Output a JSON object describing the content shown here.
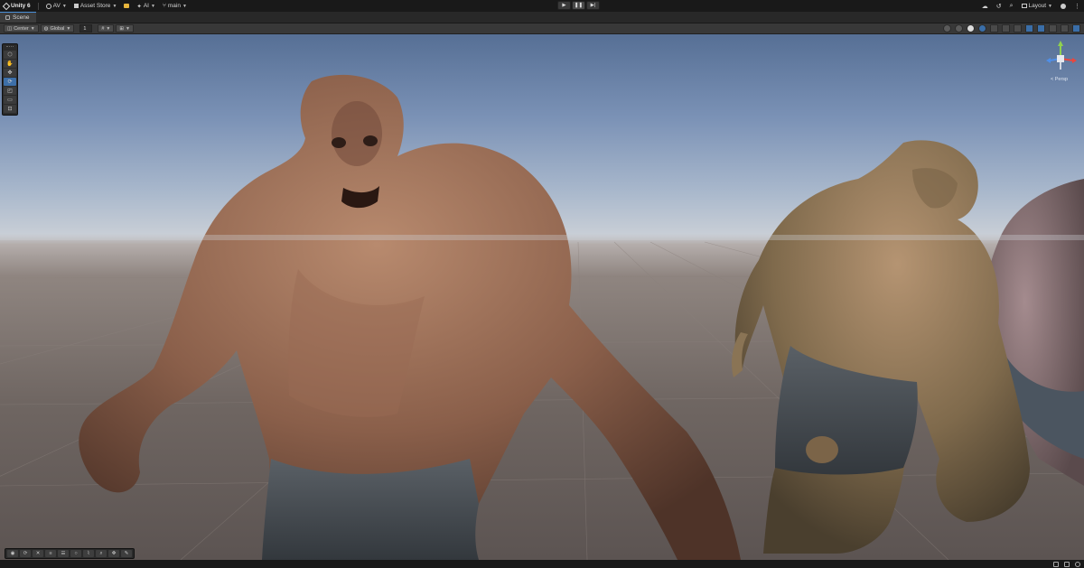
{
  "topbar": {
    "brand": "Unity 6",
    "account": "AV",
    "asset_store": "Asset Store",
    "ai": "AI",
    "branch": "main",
    "layout": "Layout"
  },
  "tabs": [
    {
      "label": "Scene"
    }
  ],
  "scenebar": {
    "pivot_mode": "Center",
    "pivot_space": "Global",
    "grid_snap_value": "1"
  },
  "gizmo": {
    "projection": "< Persp",
    "axes": {
      "y": "#8fd14f",
      "x": "#e8473f",
      "z": "#4f8fe8"
    }
  },
  "icons": {
    "cloud": "cloud-icon",
    "history": "history-icon",
    "search": "search-icon",
    "help": "help-icon",
    "menu": "kebab-icon"
  }
}
